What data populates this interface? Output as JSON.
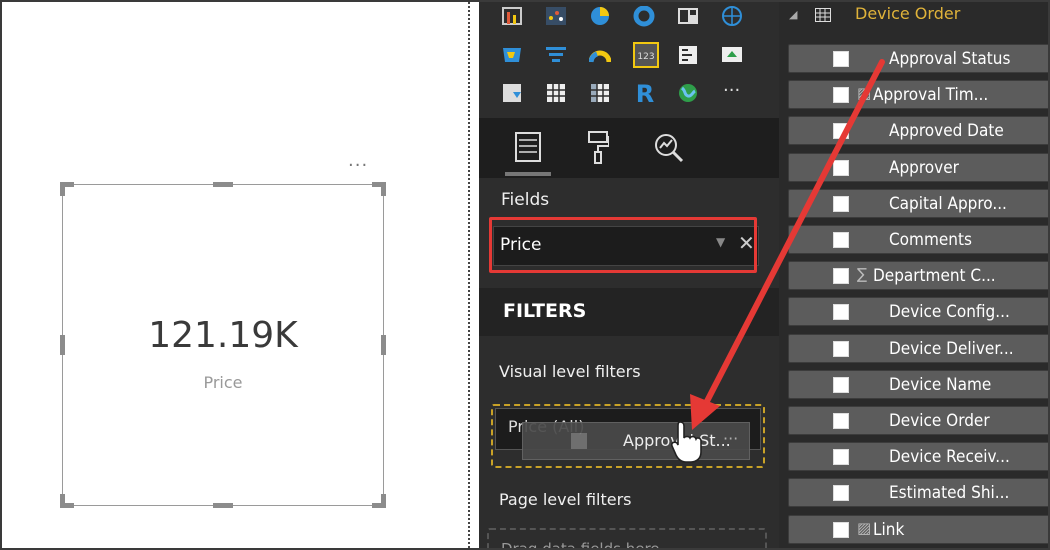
{
  "card": {
    "value": "121.19K",
    "label": "Price",
    "more": "..."
  },
  "pane": {
    "fields_label": "Fields",
    "field_well_value": "Price",
    "filters_heading": "FILTERS",
    "visual_filters_label": "Visual level filters",
    "visual_filter_pill": "Price (All)",
    "drag_ghost_label": "Approval St...",
    "drag_ghost_more": "···",
    "page_filters_label": "Page level filters",
    "drop_placeholder": "Drag data fields here",
    "viz_more": "···",
    "viz_icons": [
      "matrix-visual-icon",
      "scatter-chart-icon",
      "pie-chart-icon",
      "donut-chart-icon",
      "treemap-icon",
      "map-icon",
      "filled-map-icon",
      "funnel-icon",
      "gauge-icon",
      "card-icon",
      "multi-row-card-icon",
      "kpi-icon",
      "slicer-icon",
      "table-icon",
      "matrix-icon",
      "r-visual-icon",
      "globe-icon"
    ],
    "tabs": [
      {
        "name": "fields-tab-icon"
      },
      {
        "name": "format-tab-icon"
      },
      {
        "name": "analytics-tab-icon"
      }
    ]
  },
  "field_list": {
    "table_name": "Device Order",
    "fields": [
      {
        "label": "Approval Status",
        "sigma": ""
      },
      {
        "label": "Approval Tim...",
        "sigma": "▨"
      },
      {
        "label": "Approved Date",
        "sigma": ""
      },
      {
        "label": "Approver",
        "sigma": ""
      },
      {
        "label": "Capital Appro...",
        "sigma": ""
      },
      {
        "label": "Comments",
        "sigma": ""
      },
      {
        "label": "Department C...",
        "sigma": "∑"
      },
      {
        "label": "Device Config...",
        "sigma": ""
      },
      {
        "label": "Device Deliver...",
        "sigma": ""
      },
      {
        "label": "Device Name",
        "sigma": ""
      },
      {
        "label": "Device Order",
        "sigma": ""
      },
      {
        "label": "Device Receiv...",
        "sigma": ""
      },
      {
        "label": "Estimated Shi...",
        "sigma": ""
      },
      {
        "label": "Link",
        "sigma": "▨"
      }
    ]
  },
  "colors": {
    "accent_red": "#e53935",
    "highlight_gold": "#c9a227",
    "table_name_gold": "#e0b33a"
  }
}
